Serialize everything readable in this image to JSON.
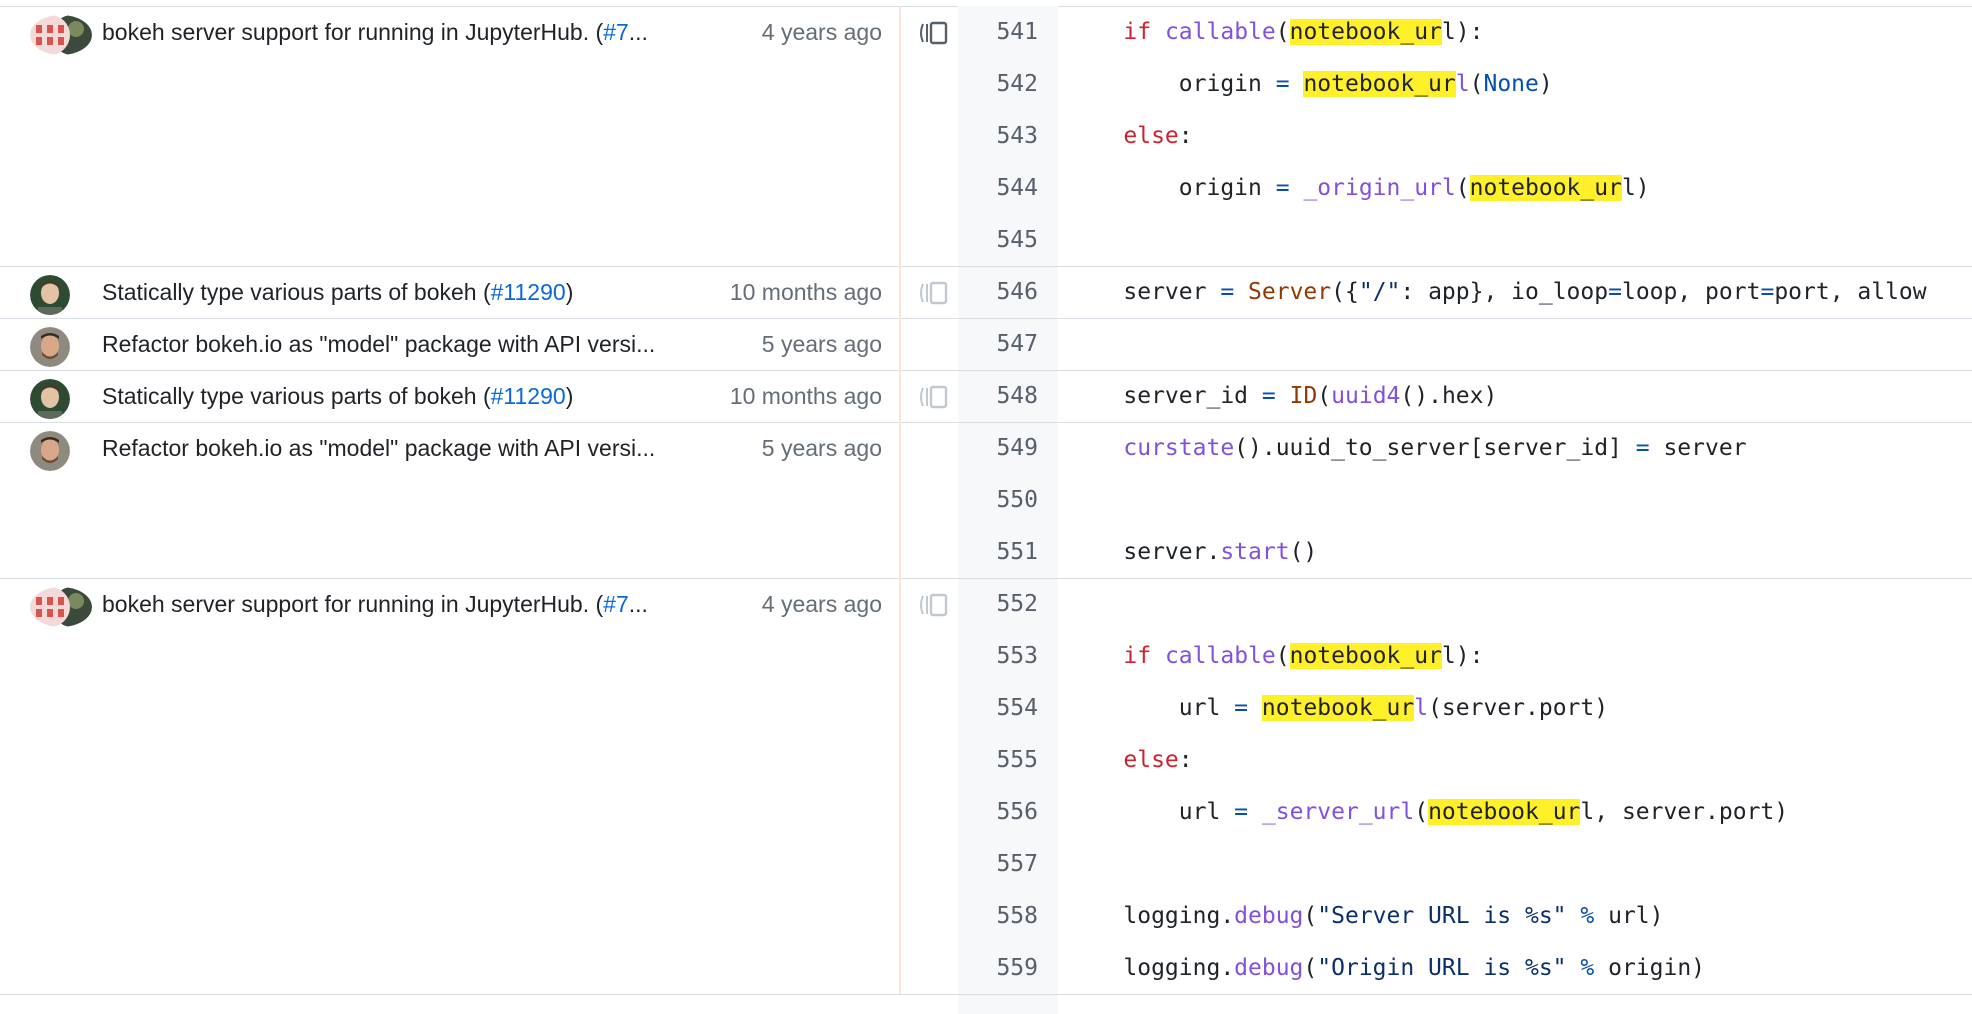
{
  "colors": {
    "keyword": "#cf222e",
    "function": "#8250df",
    "class": "#953800",
    "operator": "#0550ae",
    "string": "#0a3069",
    "match_highlight": "#fff02a",
    "link": "#0969da",
    "muted": "#656d76",
    "gutter_bg": "#f6f8fa",
    "age_bar": "#fbe5d8"
  },
  "blame_groups": [
    {
      "commit_message": "bokeh server support for running in JupyterHub. (",
      "pr_link": "#7",
      "truncated": "...",
      "age": "4 years ago",
      "avatar": "pair",
      "lines": [
        541,
        542,
        543,
        544,
        545
      ]
    },
    {
      "commit_message": "Statically type various parts of bokeh (",
      "pr_link": "#11290",
      "suffix": ")",
      "age": "10 months ago",
      "avatar": "single-a",
      "lines": [
        546
      ]
    },
    {
      "commit_message": "Refactor bokeh.io as \"model\" package with API versi...",
      "age": "5 years ago",
      "avatar": "single-b",
      "lines": [
        547
      ]
    },
    {
      "commit_message": "Statically type various parts of bokeh (",
      "pr_link": "#11290",
      "suffix": ")",
      "age": "10 months ago",
      "avatar": "single-a",
      "lines": [
        548
      ]
    },
    {
      "commit_message": "Refactor bokeh.io as \"model\" package with API versi...",
      "age": "5 years ago",
      "avatar": "single-b",
      "lines": [
        549,
        550,
        551
      ]
    },
    {
      "commit_message": "bokeh server support for running in JupyterHub. (",
      "pr_link": "#7",
      "truncated": "...",
      "age": "4 years ago",
      "avatar": "pair",
      "lines": [
        552,
        553,
        554,
        555,
        556,
        557,
        558,
        559
      ]
    }
  ],
  "code_lines": [
    {
      "n": "541",
      "tokens": [
        [
          "",
          "    "
        ],
        [
          "kw",
          "if"
        ],
        [
          "",
          " "
        ],
        [
          "fn",
          "callable"
        ],
        [
          "",
          "("
        ],
        [
          "hl",
          "notebook_ur"
        ],
        [
          "",
          "l):"
        ]
      ]
    },
    {
      "n": "542",
      "tokens": [
        [
          "",
          "        origin "
        ],
        [
          "op",
          "="
        ],
        [
          "",
          " "
        ],
        [
          "hl",
          "notebook_ur"
        ],
        [
          "fn",
          "l"
        ],
        [
          "",
          "("
        ],
        [
          "op",
          "None"
        ],
        [
          "",
          ")"
        ]
      ]
    },
    {
      "n": "543",
      "tokens": [
        [
          "",
          "    "
        ],
        [
          "kw",
          "else"
        ],
        [
          "",
          ":"
        ]
      ]
    },
    {
      "n": "544",
      "tokens": [
        [
          "",
          "        origin "
        ],
        [
          "op",
          "="
        ],
        [
          "",
          " "
        ],
        [
          "fn",
          "_origin_url"
        ],
        [
          "",
          "("
        ],
        [
          "hl",
          "notebook_ur"
        ],
        [
          "",
          "l)"
        ]
      ]
    },
    {
      "n": "545",
      "tokens": []
    },
    {
      "n": "546",
      "tokens": [
        [
          "",
          "    server "
        ],
        [
          "op",
          "="
        ],
        [
          "",
          " "
        ],
        [
          "cls",
          "Server"
        ],
        [
          "",
          "({"
        ],
        [
          "str",
          "\"/\""
        ],
        [
          "",
          ": app}, io_loop"
        ],
        [
          "op",
          "="
        ],
        [
          "",
          "loop, port"
        ],
        [
          "op",
          "="
        ],
        [
          "",
          "port, allow"
        ]
      ]
    },
    {
      "n": "547",
      "tokens": []
    },
    {
      "n": "548",
      "tokens": [
        [
          "",
          "    server_id "
        ],
        [
          "op",
          "="
        ],
        [
          "",
          " "
        ],
        [
          "cls",
          "ID"
        ],
        [
          "",
          "("
        ],
        [
          "fn",
          "uuid4"
        ],
        [
          "",
          "().hex)"
        ]
      ]
    },
    {
      "n": "549",
      "tokens": [
        [
          "",
          "    "
        ],
        [
          "fn",
          "curstate"
        ],
        [
          "",
          "().uuid_to_server[server_id] "
        ],
        [
          "op",
          "="
        ],
        [
          "",
          " server"
        ]
      ]
    },
    {
      "n": "550",
      "tokens": []
    },
    {
      "n": "551",
      "tokens": [
        [
          "",
          "    server."
        ],
        [
          "fn",
          "start"
        ],
        [
          "",
          "()"
        ]
      ]
    },
    {
      "n": "552",
      "tokens": []
    },
    {
      "n": "553",
      "tokens": [
        [
          "",
          "    "
        ],
        [
          "kw",
          "if"
        ],
        [
          "",
          " "
        ],
        [
          "fn",
          "callable"
        ],
        [
          "",
          "("
        ],
        [
          "hl",
          "notebook_ur"
        ],
        [
          "",
          "l):"
        ]
      ]
    },
    {
      "n": "554",
      "tokens": [
        [
          "",
          "        url "
        ],
        [
          "op",
          "="
        ],
        [
          "",
          " "
        ],
        [
          "hl",
          "notebook_ur"
        ],
        [
          "fn",
          "l"
        ],
        [
          "",
          "(server.port)"
        ]
      ]
    },
    {
      "n": "555",
      "tokens": [
        [
          "",
          "    "
        ],
        [
          "kw",
          "else"
        ],
        [
          "",
          ":"
        ]
      ]
    },
    {
      "n": "556",
      "tokens": [
        [
          "",
          "        url "
        ],
        [
          "op",
          "="
        ],
        [
          "",
          " "
        ],
        [
          "fn",
          "_server_url"
        ],
        [
          "",
          "("
        ],
        [
          "hl",
          "notebook_ur"
        ],
        [
          "",
          "l, server.port)"
        ]
      ]
    },
    {
      "n": "557",
      "tokens": []
    },
    {
      "n": "558",
      "tokens": [
        [
          "",
          "    logging."
        ],
        [
          "fn",
          "debug"
        ],
        [
          "",
          "("
        ],
        [
          "str",
          "\"Server URL is %s\""
        ],
        [
          "",
          " "
        ],
        [
          "op",
          "%"
        ],
        [
          "",
          " url)"
        ]
      ]
    },
    {
      "n": "559",
      "tokens": [
        [
          "",
          "    logging."
        ],
        [
          "fn",
          "debug"
        ],
        [
          "",
          "("
        ],
        [
          "str",
          "\"Origin URL is %s\""
        ],
        [
          "",
          " "
        ],
        [
          "op",
          "%"
        ],
        [
          "",
          " origin)"
        ]
      ]
    }
  ]
}
